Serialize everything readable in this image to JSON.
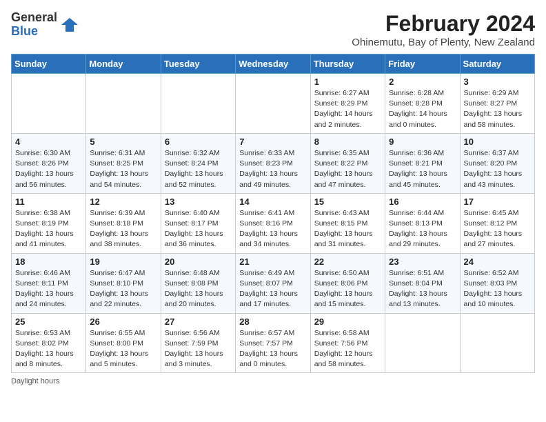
{
  "header": {
    "logo_general": "General",
    "logo_blue": "Blue",
    "month_year": "February 2024",
    "location": "Ohinemutu, Bay of Plenty, New Zealand"
  },
  "weekdays": [
    "Sunday",
    "Monday",
    "Tuesday",
    "Wednesday",
    "Thursday",
    "Friday",
    "Saturday"
  ],
  "weeks": [
    [
      {
        "day": "",
        "info": ""
      },
      {
        "day": "",
        "info": ""
      },
      {
        "day": "",
        "info": ""
      },
      {
        "day": "",
        "info": ""
      },
      {
        "day": "1",
        "info": "Sunrise: 6:27 AM\nSunset: 8:29 PM\nDaylight: 14 hours\nand 2 minutes."
      },
      {
        "day": "2",
        "info": "Sunrise: 6:28 AM\nSunset: 8:28 PM\nDaylight: 14 hours\nand 0 minutes."
      },
      {
        "day": "3",
        "info": "Sunrise: 6:29 AM\nSunset: 8:27 PM\nDaylight: 13 hours\nand 58 minutes."
      }
    ],
    [
      {
        "day": "4",
        "info": "Sunrise: 6:30 AM\nSunset: 8:26 PM\nDaylight: 13 hours\nand 56 minutes."
      },
      {
        "day": "5",
        "info": "Sunrise: 6:31 AM\nSunset: 8:25 PM\nDaylight: 13 hours\nand 54 minutes."
      },
      {
        "day": "6",
        "info": "Sunrise: 6:32 AM\nSunset: 8:24 PM\nDaylight: 13 hours\nand 52 minutes."
      },
      {
        "day": "7",
        "info": "Sunrise: 6:33 AM\nSunset: 8:23 PM\nDaylight: 13 hours\nand 49 minutes."
      },
      {
        "day": "8",
        "info": "Sunrise: 6:35 AM\nSunset: 8:22 PM\nDaylight: 13 hours\nand 47 minutes."
      },
      {
        "day": "9",
        "info": "Sunrise: 6:36 AM\nSunset: 8:21 PM\nDaylight: 13 hours\nand 45 minutes."
      },
      {
        "day": "10",
        "info": "Sunrise: 6:37 AM\nSunset: 8:20 PM\nDaylight: 13 hours\nand 43 minutes."
      }
    ],
    [
      {
        "day": "11",
        "info": "Sunrise: 6:38 AM\nSunset: 8:19 PM\nDaylight: 13 hours\nand 41 minutes."
      },
      {
        "day": "12",
        "info": "Sunrise: 6:39 AM\nSunset: 8:18 PM\nDaylight: 13 hours\nand 38 minutes."
      },
      {
        "day": "13",
        "info": "Sunrise: 6:40 AM\nSunset: 8:17 PM\nDaylight: 13 hours\nand 36 minutes."
      },
      {
        "day": "14",
        "info": "Sunrise: 6:41 AM\nSunset: 8:16 PM\nDaylight: 13 hours\nand 34 minutes."
      },
      {
        "day": "15",
        "info": "Sunrise: 6:43 AM\nSunset: 8:15 PM\nDaylight: 13 hours\nand 31 minutes."
      },
      {
        "day": "16",
        "info": "Sunrise: 6:44 AM\nSunset: 8:13 PM\nDaylight: 13 hours\nand 29 minutes."
      },
      {
        "day": "17",
        "info": "Sunrise: 6:45 AM\nSunset: 8:12 PM\nDaylight: 13 hours\nand 27 minutes."
      }
    ],
    [
      {
        "day": "18",
        "info": "Sunrise: 6:46 AM\nSunset: 8:11 PM\nDaylight: 13 hours\nand 24 minutes."
      },
      {
        "day": "19",
        "info": "Sunrise: 6:47 AM\nSunset: 8:10 PM\nDaylight: 13 hours\nand 22 minutes."
      },
      {
        "day": "20",
        "info": "Sunrise: 6:48 AM\nSunset: 8:08 PM\nDaylight: 13 hours\nand 20 minutes."
      },
      {
        "day": "21",
        "info": "Sunrise: 6:49 AM\nSunset: 8:07 PM\nDaylight: 13 hours\nand 17 minutes."
      },
      {
        "day": "22",
        "info": "Sunrise: 6:50 AM\nSunset: 8:06 PM\nDaylight: 13 hours\nand 15 minutes."
      },
      {
        "day": "23",
        "info": "Sunrise: 6:51 AM\nSunset: 8:04 PM\nDaylight: 13 hours\nand 13 minutes."
      },
      {
        "day": "24",
        "info": "Sunrise: 6:52 AM\nSunset: 8:03 PM\nDaylight: 13 hours\nand 10 minutes."
      }
    ],
    [
      {
        "day": "25",
        "info": "Sunrise: 6:53 AM\nSunset: 8:02 PM\nDaylight: 13 hours\nand 8 minutes."
      },
      {
        "day": "26",
        "info": "Sunrise: 6:55 AM\nSunset: 8:00 PM\nDaylight: 13 hours\nand 5 minutes."
      },
      {
        "day": "27",
        "info": "Sunrise: 6:56 AM\nSunset: 7:59 PM\nDaylight: 13 hours\nand 3 minutes."
      },
      {
        "day": "28",
        "info": "Sunrise: 6:57 AM\nSunset: 7:57 PM\nDaylight: 13 hours\nand 0 minutes."
      },
      {
        "day": "29",
        "info": "Sunrise: 6:58 AM\nSunset: 7:56 PM\nDaylight: 12 hours\nand 58 minutes."
      },
      {
        "day": "",
        "info": ""
      },
      {
        "day": "",
        "info": ""
      }
    ]
  ],
  "footer": {
    "daylight_label": "Daylight hours"
  }
}
